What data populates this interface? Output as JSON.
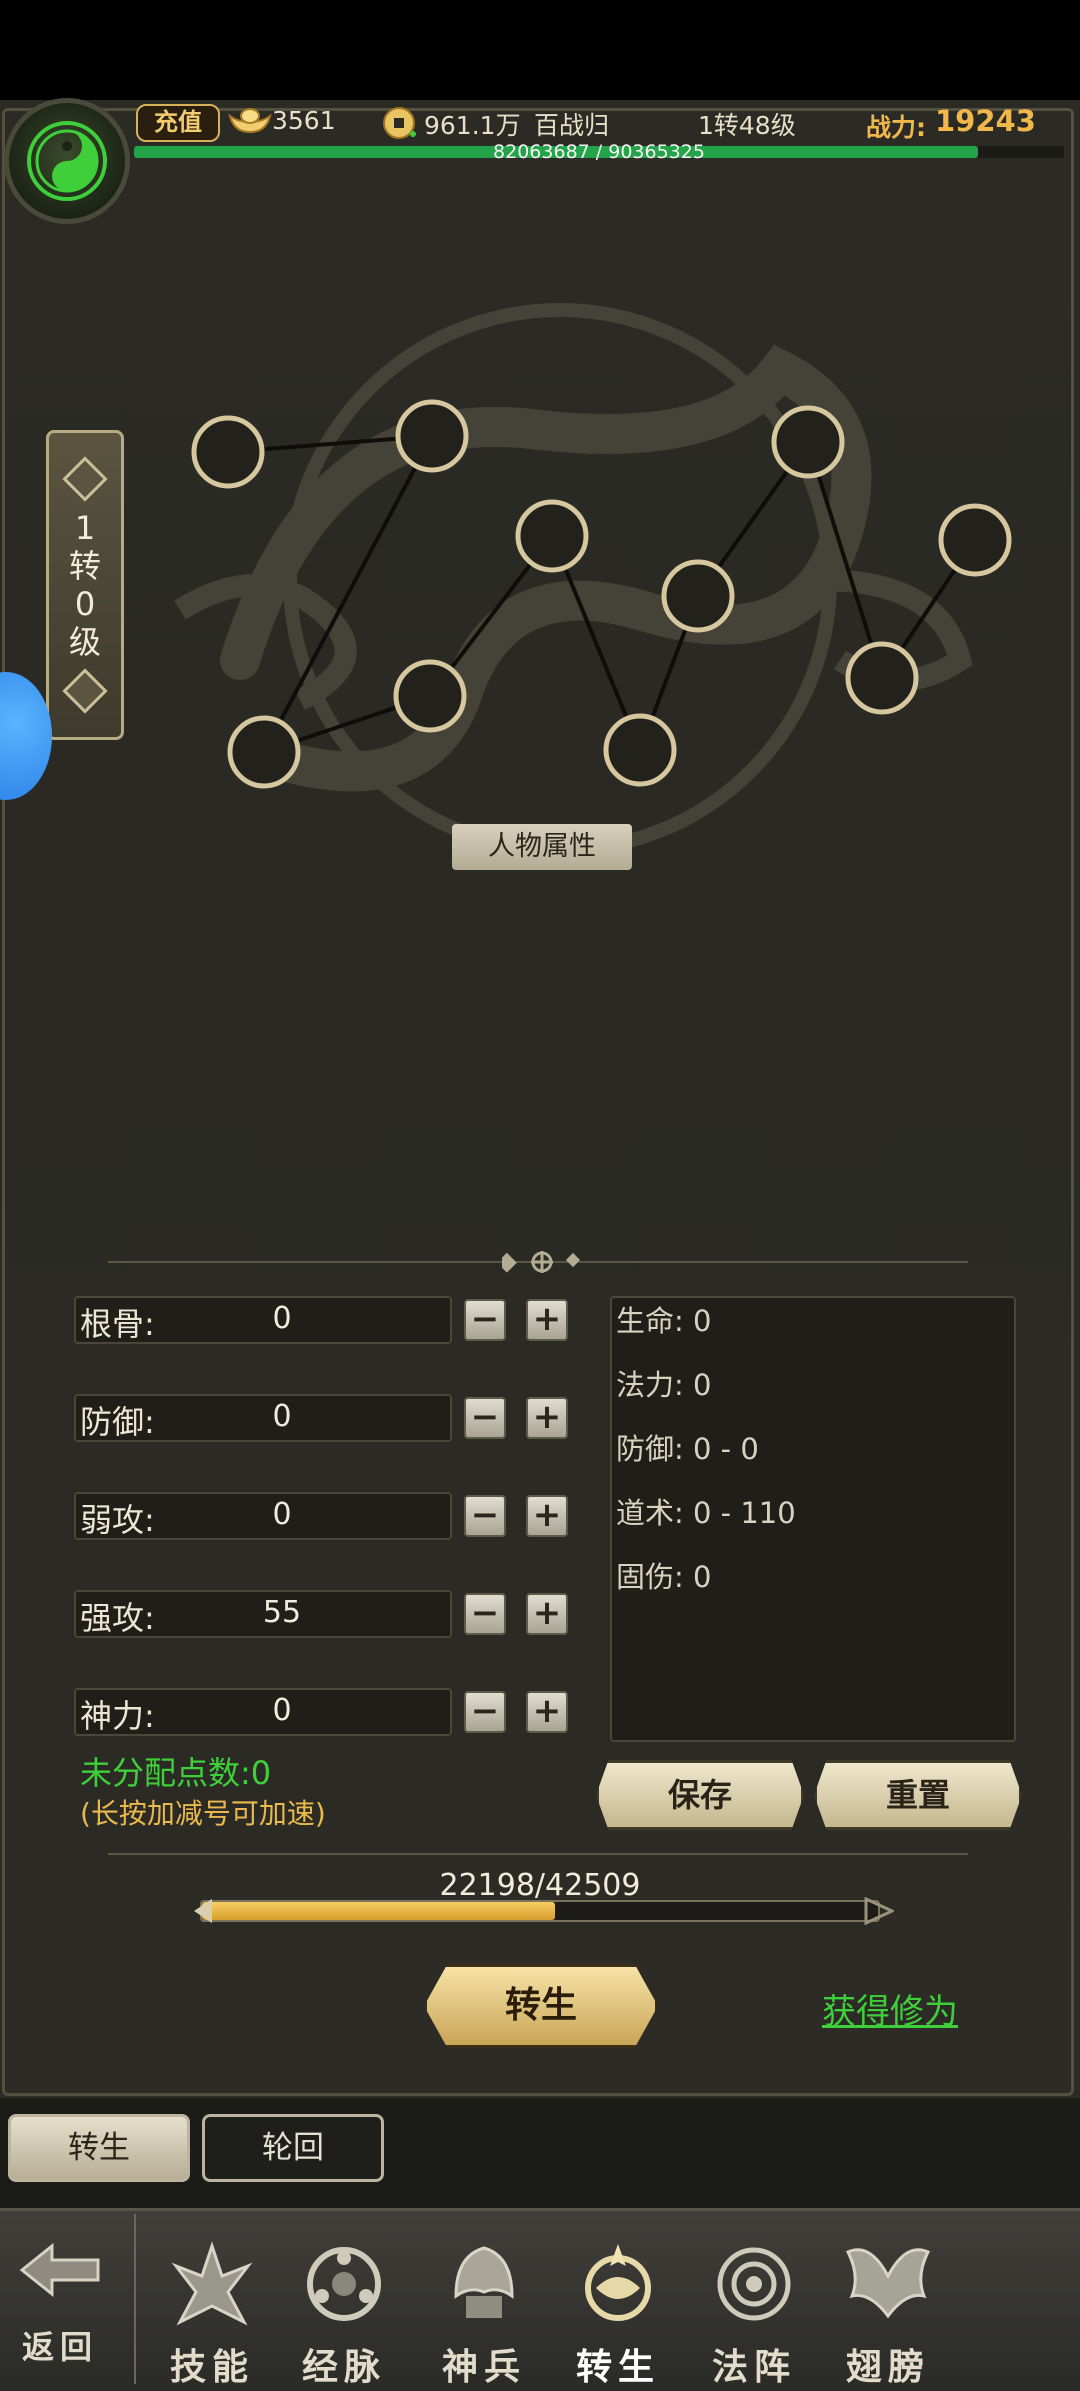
{
  "status": {
    "recharge": "充值",
    "ingots": "3561",
    "coins": "961.1万",
    "title": "百战归",
    "level": "1转48级",
    "power_label": "战力:",
    "power_value": "19243",
    "exp_text": "82063687 / 90365325",
    "exp_progress": 0.908
  },
  "rebirth_plaque": [
    "1",
    "转",
    "0",
    "级"
  ],
  "constellation": {
    "nodes": [
      [
        1,
        2
      ],
      [
        2,
        4
      ],
      [
        4,
        3
      ],
      [
        3,
        5
      ],
      [
        5,
        6
      ],
      [
        6,
        7
      ],
      [
        7,
        8
      ],
      [
        8,
        9
      ],
      [
        9,
        10
      ],
      [
        10,
        11
      ]
    ],
    "attr_button": "人物属性"
  },
  "allocation": {
    "rows": [
      {
        "label": "根骨:",
        "value": "0"
      },
      {
        "label": "防御:",
        "value": "0"
      },
      {
        "label": "弱攻:",
        "value": "0"
      },
      {
        "label": "强攻:",
        "value": "55"
      },
      {
        "label": "神力:",
        "value": "0"
      }
    ],
    "minus": "−",
    "plus": "+",
    "unallocated": "未分配点数:0",
    "hint": "(长按加减号可加速)",
    "save": "保存",
    "reset": "重置"
  },
  "stats": [
    "生命: 0",
    "法力: 0",
    "防御: 0 - 0",
    "道术: 0 - 110",
    "固伤: 0"
  ],
  "rebirth": {
    "progress_text": "22198/42509",
    "progress": 0.522,
    "button": "转生",
    "gain_link": "获得修为"
  },
  "subtabs": [
    "转生",
    "轮回"
  ],
  "nav": {
    "back": "返回",
    "items": [
      {
        "label": "技能",
        "icon": "skill-icon"
      },
      {
        "label": "经脉",
        "icon": "meridian-icon"
      },
      {
        "label": "神兵",
        "icon": "weapon-icon"
      },
      {
        "label": "转生",
        "icon": "rebirth-icon"
      },
      {
        "label": "法阵",
        "icon": "array-icon"
      },
      {
        "label": "翅膀",
        "icon": "wings-icon"
      }
    ]
  },
  "colors": {
    "accent_gold": "#f0b84a",
    "green": "#3fcf3a",
    "panel_bg": "#2b2a24"
  }
}
